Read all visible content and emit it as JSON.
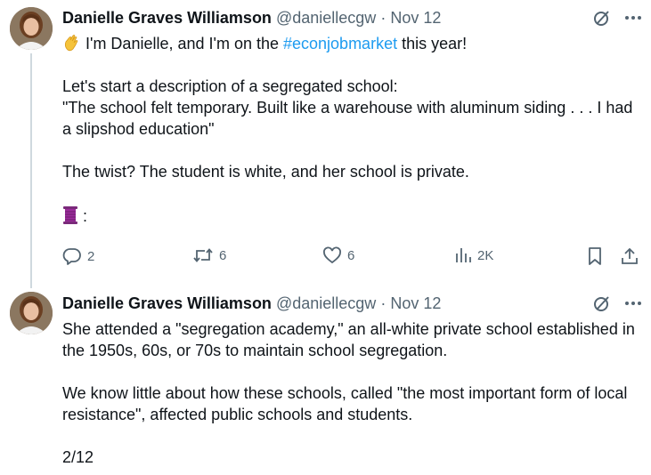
{
  "tweets": [
    {
      "name": "Danielle Graves Williamson",
      "handle": "@daniellecgw",
      "sep": "·",
      "date": "Nov 12",
      "intro_pre": "I'm Danielle, and I'm on the ",
      "hashtag": "#econjobmarket",
      "intro_post": " this year!",
      "line2": "Let's start a description of a segregated school:",
      "line3": "\"The school felt temporary. Built like a warehouse with aluminum siding . . . I had a slipshod education\"",
      "line4": "The twist? The student is white, and her school is private.",
      "thread_marker": ":",
      "stats": {
        "replies": "2",
        "retweets": "6",
        "likes": "6",
        "views": "2K"
      }
    },
    {
      "name": "Danielle Graves Williamson",
      "handle": "@daniellecgw",
      "sep": "·",
      "date": "Nov 12",
      "para1": "She attended a \"segregation academy,\" an all-white private school established in the 1950s, 60s, or 70s to maintain school segregation.",
      "para2": "We know little about how these schools, called \"the most important form of local resistance\", affected public schools and students.",
      "counter": "2/12"
    }
  ],
  "colors": {
    "link": "#1d9bf0",
    "muted": "#536471",
    "text": "#0f1419",
    "thread_line": "#cfd9de"
  },
  "icons": [
    "grok-icon",
    "more-icon",
    "reply-icon",
    "retweet-icon",
    "like-icon",
    "views-icon",
    "bookmark-icon",
    "share-icon",
    "waving-hand-emoji",
    "thread-spool-emoji"
  ]
}
